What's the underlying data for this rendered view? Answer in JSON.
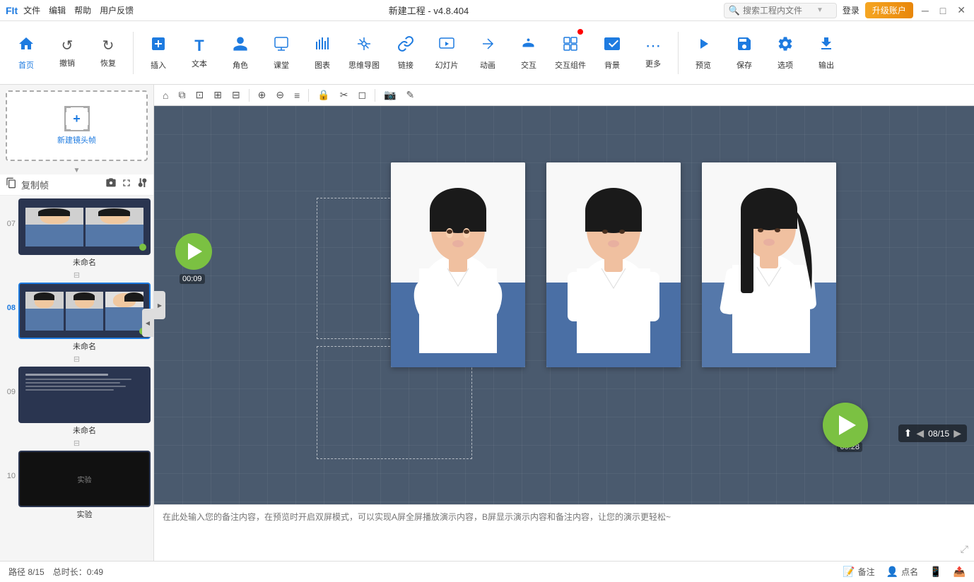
{
  "titlebar": {
    "logo": "FIt",
    "menu": [
      "文件",
      "编辑",
      "帮助",
      "用户反馈"
    ],
    "title": "新建工程 - v4.8.404",
    "search_placeholder": "搜索工程内文件",
    "login_label": "登录",
    "upgrade_label": "升级账户",
    "win_minimize": "─",
    "win_maximize": "□",
    "win_close": "✕"
  },
  "toolbar": {
    "items": [
      {
        "id": "home",
        "icon": "⊕",
        "label": "首页",
        "active": true
      },
      {
        "id": "undo",
        "icon": "↺",
        "label": "撤销"
      },
      {
        "id": "redo",
        "icon": "↻",
        "label": "恢复"
      },
      {
        "sep": true
      },
      {
        "id": "insert",
        "icon": "⊕",
        "label": "插入"
      },
      {
        "id": "text",
        "icon": "T",
        "label": "文本"
      },
      {
        "id": "role",
        "icon": "👤",
        "label": "角色"
      },
      {
        "id": "class",
        "icon": "📋",
        "label": "课堂"
      },
      {
        "id": "chart",
        "icon": "📊",
        "label": "图表"
      },
      {
        "id": "mindmap",
        "icon": "🧠",
        "label": "思维导图"
      },
      {
        "id": "link",
        "icon": "🔗",
        "label": "链接"
      },
      {
        "id": "slide",
        "icon": "🖼",
        "label": "幻灯片"
      },
      {
        "id": "anim",
        "icon": "✨",
        "label": "动画"
      },
      {
        "id": "interact",
        "icon": "🖱",
        "label": "交互"
      },
      {
        "id": "interact_comp",
        "icon": "⚙",
        "label": "交互组件"
      },
      {
        "id": "bg",
        "icon": "🖼",
        "label": "背景"
      },
      {
        "id": "more",
        "icon": "⋯",
        "label": "更多"
      },
      {
        "id": "preview",
        "icon": "▶",
        "label": "预览"
      },
      {
        "id": "save",
        "icon": "💾",
        "label": "保存"
      },
      {
        "id": "option",
        "icon": "⚙",
        "label": "选项"
      },
      {
        "id": "export",
        "icon": "📤",
        "label": "输出"
      }
    ]
  },
  "canvas_toolbar": {
    "icons": [
      "⊕",
      "⧉",
      "⊡",
      "⊡",
      "⊡",
      "⊡",
      "⊕",
      "⊖",
      "≡",
      "⊡",
      "⊡",
      "⊡",
      "⊡",
      "✎"
    ]
  },
  "slide_panel": {
    "new_frame_label": "新建镜头帧",
    "copy_btn": "复制帧",
    "slides": [
      {
        "num": "07",
        "label": "未命名",
        "active": false,
        "dot_color": "green",
        "type": "persons"
      },
      {
        "num": "08",
        "label": "未命名",
        "active": true,
        "dot_color": "green",
        "type": "persons"
      },
      {
        "num": "09",
        "label": "未命名",
        "active": false,
        "dot_color": "",
        "type": "text"
      },
      {
        "num": "10",
        "label": "实验",
        "active": false,
        "dot_color": "",
        "type": "dark"
      }
    ]
  },
  "canvas": {
    "play_time_tl": "00:09",
    "play_time_br": "00:28",
    "slide_num": "8",
    "photos": [
      {
        "id": "photo1",
        "alt": "女性照片1"
      },
      {
        "id": "photo2",
        "alt": "女性照片2"
      },
      {
        "id": "photo3",
        "alt": "女性照片3"
      }
    ]
  },
  "notes": {
    "placeholder": "在此处输入您的备注内容，在预览时开启双屏模式，可以实现A屏全屏播放演示内容，B屏显示演示内容和备注内容，让您的演示更轻松~"
  },
  "page_nav": {
    "current": "08",
    "total": "15"
  },
  "status_bar": {
    "path": "路径 8/15",
    "total_time": "总时长：0:49",
    "note_btn": "备注",
    "point_btn": "点名",
    "icon1": "📷",
    "icon2": "👤",
    "icon3": "📱",
    "icon4": "📤"
  }
}
